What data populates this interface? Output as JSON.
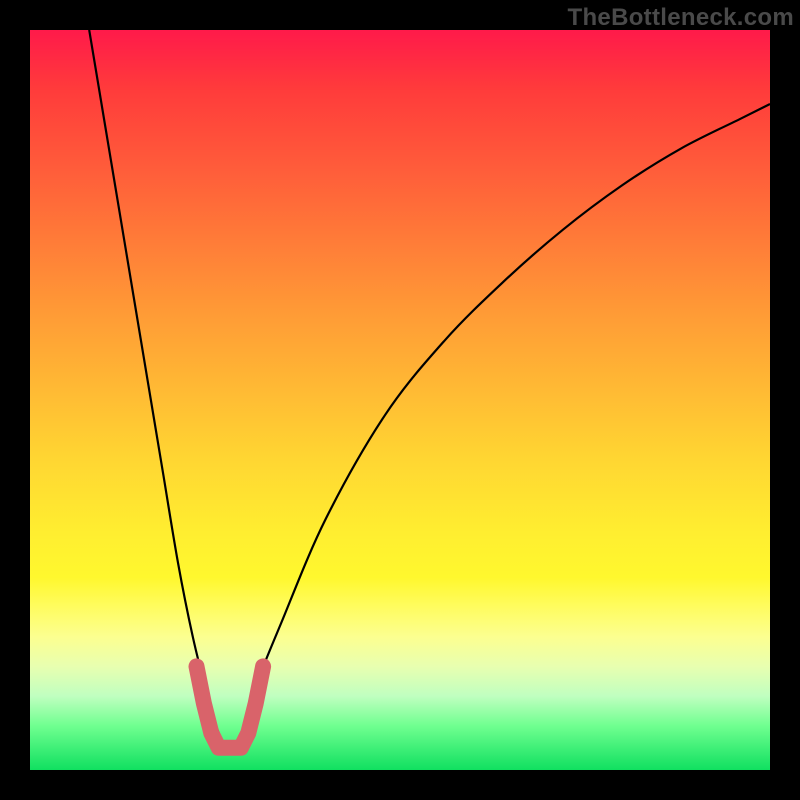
{
  "attribution": "TheBottleneck.com",
  "chart_data": {
    "type": "line",
    "title": "",
    "xlabel": "",
    "ylabel": "",
    "xlim": [
      0,
      100
    ],
    "ylim": [
      0,
      100
    ],
    "grid": false,
    "legend": false,
    "series": [
      {
        "name": "bottleneck-curve",
        "x": [
          8,
          10,
          12,
          14,
          16,
          18,
          20,
          22,
          24,
          25.5,
          27,
          29,
          30,
          34,
          40,
          48,
          56,
          64,
          72,
          80,
          88,
          96,
          100
        ],
        "y": [
          100,
          88,
          76,
          64,
          52,
          40,
          28,
          18,
          10,
          5,
          3,
          5,
          10,
          20,
          34,
          48,
          58,
          66,
          73,
          79,
          84,
          88,
          90
        ],
        "color": "#000000"
      },
      {
        "name": "optimal-range-marker",
        "x": [
          22.5,
          23.5,
          24.5,
          25.5,
          27,
          28.5,
          29.5,
          30.5,
          31.5
        ],
        "y": [
          14,
          9,
          5,
          3,
          3,
          3,
          5,
          9,
          14
        ],
        "color": "#d9636a"
      }
    ],
    "background_gradient": {
      "top": "#ff1a4a",
      "bottom": "#10e060"
    }
  }
}
